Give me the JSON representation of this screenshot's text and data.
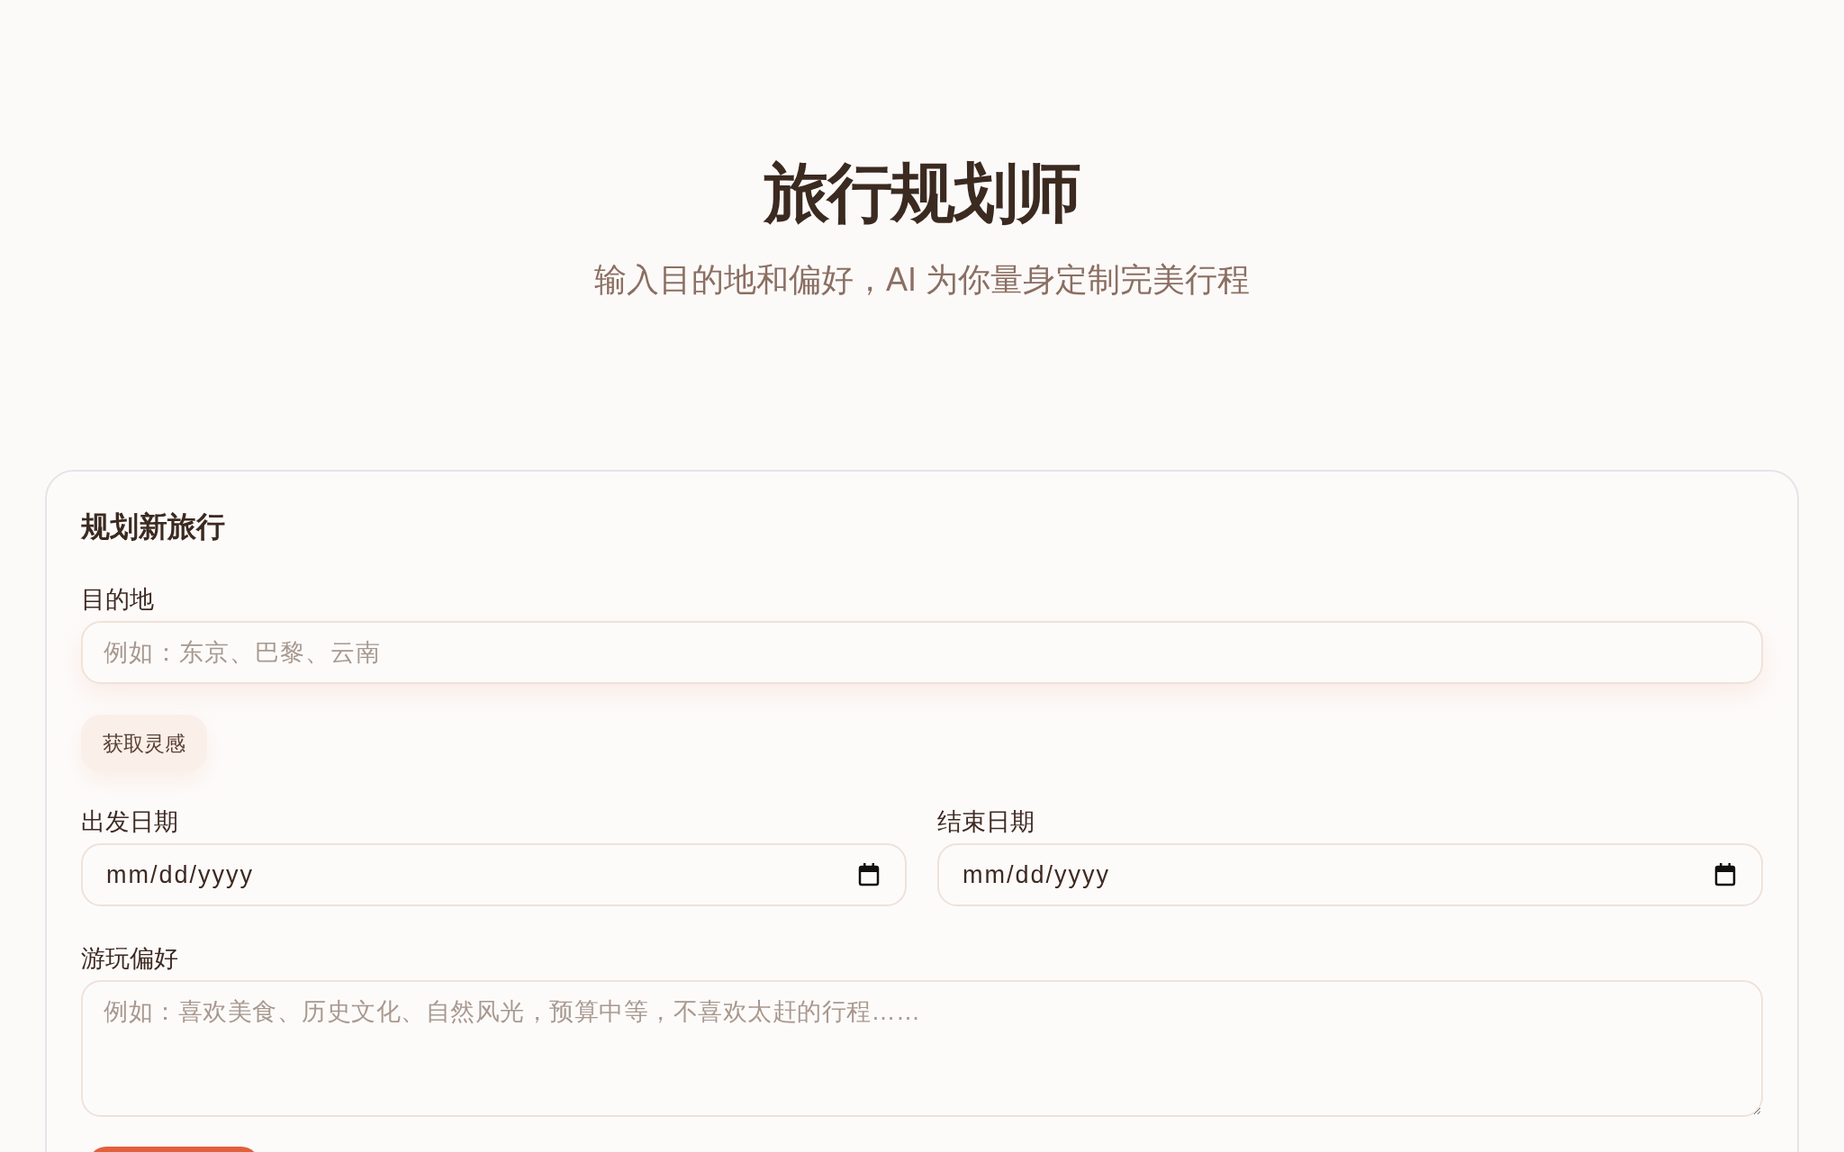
{
  "header": {
    "title": "旅行规划师",
    "subtitle": "输入目的地和偏好，AI 为你量身定制完美行程"
  },
  "form": {
    "title": "规划新旅行",
    "destination": {
      "label": "目的地",
      "placeholder": "例如：东京、巴黎、云南"
    },
    "inspiration_button": "获取灵感",
    "dates": [
      {
        "label": "出发日期",
        "placeholder": "mm/dd/yyyy"
      },
      {
        "label": "结束日期",
        "placeholder": "mm/dd/yyyy"
      }
    ],
    "preferences": {
      "label": "游玩偏好",
      "placeholder": "例如：喜欢美食、历史文化、自然风光，预算中等，不喜欢太赶的行程……"
    }
  }
}
